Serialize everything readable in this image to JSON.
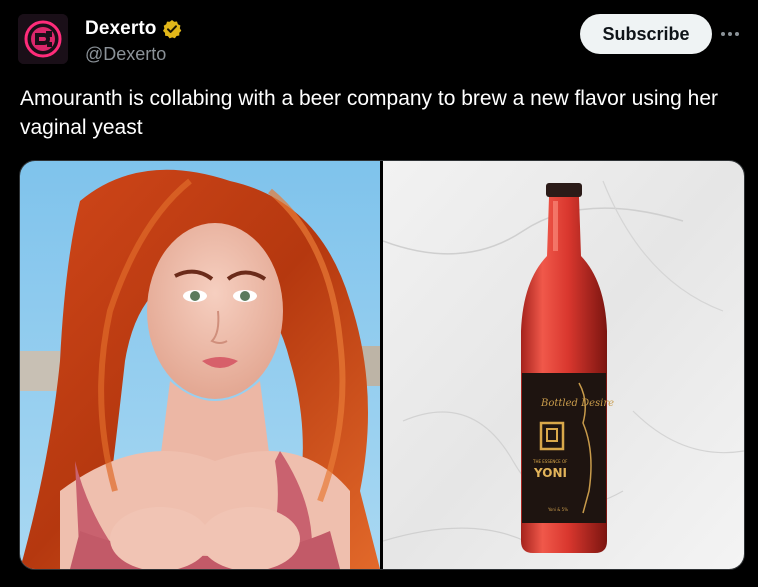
{
  "author": {
    "display_name": "Dexerto",
    "handle": "@Dexerto",
    "verified": true,
    "verified_badge_color": "#e2b719",
    "avatar_icon": "dexerto-logo-icon"
  },
  "actions": {
    "subscribe_label": "Subscribe",
    "more_icon": "more-options-icon"
  },
  "tweet": {
    "text": "Amouranth is collabing with a beer company to brew a new flavor using her vaginal yeast"
  },
  "media": {
    "images": [
      {
        "description_icon": "photo-person"
      },
      {
        "description_icon": "photo-beer-bottle"
      }
    ],
    "bottle_label": {
      "brand_script": "Bottled Desire",
      "small_text": "THE ESSENCE OF",
      "name": "YONI",
      "footer": "Yoni & 5%"
    }
  },
  "colors": {
    "background": "#000000",
    "text_primary": "#ffffff",
    "text_secondary": "#8b9298",
    "button_bg": "#eff3f4",
    "button_text": "#0f1419",
    "brand_pink": "#ff2c7a"
  }
}
